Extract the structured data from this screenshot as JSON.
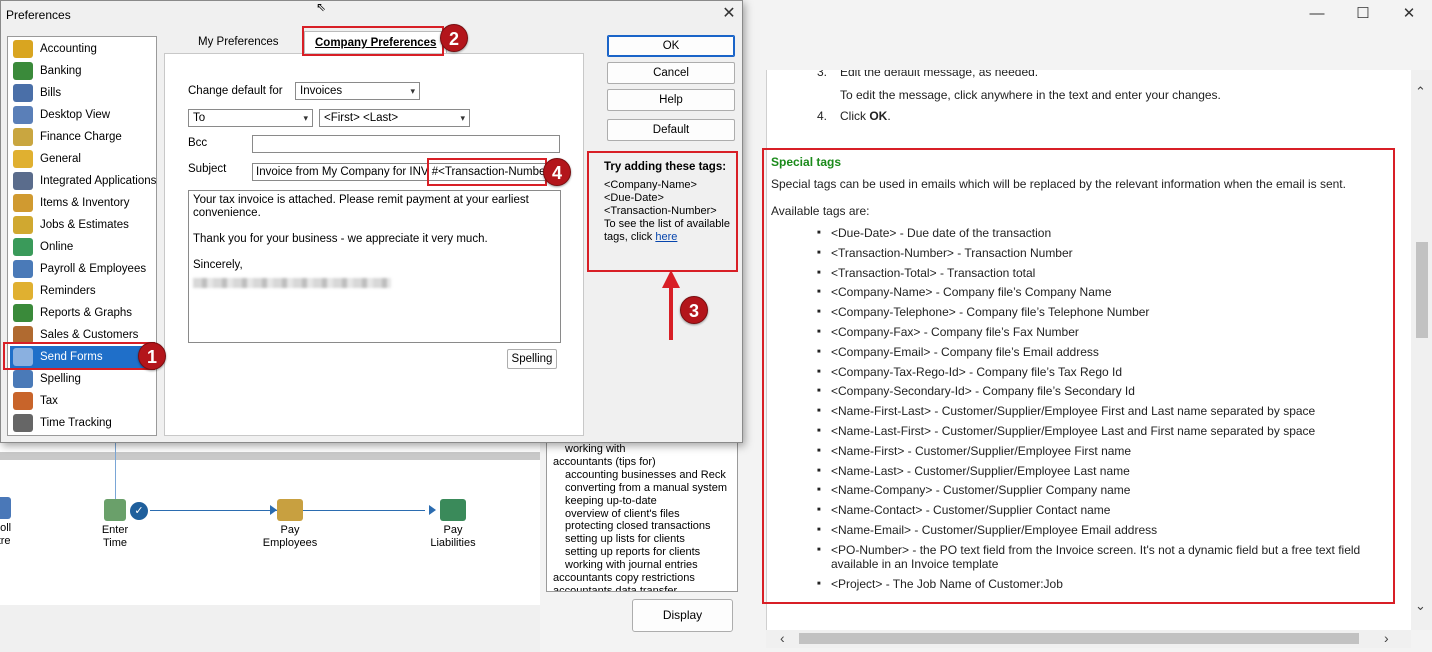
{
  "workflow": {
    "items": [
      {
        "label1": "ayroll",
        "label2": "entre"
      },
      {
        "label1": "Enter",
        "label2": "Time"
      },
      {
        "label1": "Pay",
        "label2": "Employees"
      },
      {
        "label1": "Pay",
        "label2": "Liabilities"
      }
    ]
  },
  "help_index": {
    "items": [
      {
        "text": "working with",
        "indent": 1
      },
      {
        "text": "accountants (tips for)",
        "indent": 0
      },
      {
        "text": "accounting businesses and Reck",
        "indent": 1
      },
      {
        "text": "converting from a manual system",
        "indent": 1
      },
      {
        "text": "keeping up-to-date",
        "indent": 1
      },
      {
        "text": "overview of client's files",
        "indent": 1
      },
      {
        "text": "protecting closed transactions",
        "indent": 1
      },
      {
        "text": "setting up lists for clients",
        "indent": 1
      },
      {
        "text": "setting up reports for clients",
        "indent": 1
      },
      {
        "text": "working with journal entries",
        "indent": 1
      },
      {
        "text": "accountants copy restrictions",
        "indent": 0
      },
      {
        "text": "accountants data transfer",
        "indent": 0
      }
    ],
    "display_button": "Display"
  },
  "help": {
    "step3_num": "3.",
    "step3_text": "Edit the default message, as needed.",
    "step3_sub": "To edit the message, click anywhere in the text and enter your changes.",
    "step4_num": "4.",
    "step4_text": "Click ",
    "step4_bold": "OK",
    "step4_end": ".",
    "special_title": "Special tags",
    "special_desc": "Special tags can be used in emails which will be replaced by the relevant information when the email is sent.",
    "available": "Available tags are:",
    "tags": [
      "<Due-Date> - Due date of the transaction",
      "<Transaction-Number> - Transaction Number",
      "<Transaction-Total> - Transaction total",
      "<Company-Name> - Company file’s Company Name",
      "<Company-Telephone> - Company file’s Telephone Number",
      "<Company-Fax> - Company file’s Fax Number",
      "<Company-Email> - Company file’s Email address",
      "<Company-Tax-Rego-Id> - Company file’s Tax Rego Id",
      "<Company-Secondary-Id> - Company file’s Secondary Id",
      "<Name-First-Last> - Customer/Supplier/Employee First and Last name separated by space",
      "<Name-Last-First> - Customer/Supplier/Employee Last and First name separated by space",
      "<Name-First> - Customer/Supplier/Employee First name",
      "<Name-Last> - Customer/Supplier/Employee Last name",
      "<Name-Company> - Customer/Supplier Company name",
      "<Name-Contact> - Customer/Supplier Contact name",
      "<Name-Email> - Customer/Supplier/Employee Email address",
      "<PO-Number> - the PO text field from the Invoice screen. It's not a dynamic field but a free text field available in an Invoice template",
      "<Project> - The Job Name of Customer:Job"
    ]
  },
  "preferences": {
    "title": "Preferences",
    "categories": [
      {
        "label": "Accounting",
        "color": "#d9a520"
      },
      {
        "label": "Banking",
        "color": "#3a8a3a"
      },
      {
        "label": "Bills",
        "color": "#4a6fa8"
      },
      {
        "label": "Desktop View",
        "color": "#5a7fb8"
      },
      {
        "label": "Finance Charge",
        "color": "#c9a640"
      },
      {
        "label": "General",
        "color": "#e0b030"
      },
      {
        "label": "Integrated Applications",
        "color": "#5a6c8c"
      },
      {
        "label": "Items & Inventory",
        "color": "#d09a30"
      },
      {
        "label": "Jobs & Estimates",
        "color": "#d0a830"
      },
      {
        "label": "Online",
        "color": "#3a9a5a"
      },
      {
        "label": "Payroll & Employees",
        "color": "#4a7ab8"
      },
      {
        "label": "Reminders",
        "color": "#e0b030"
      },
      {
        "label": "Reports & Graphs",
        "color": "#3a8a3a"
      },
      {
        "label": "Sales & Customers",
        "color": "#b06a30"
      },
      {
        "label": "Send Forms",
        "color": "#8ab0e0"
      },
      {
        "label": "Spelling",
        "color": "#4a7ab8"
      },
      {
        "label": "Tax",
        "color": "#c8642a"
      },
      {
        "label": "Time Tracking",
        "color": "#666666"
      }
    ],
    "selected_category": "Send Forms",
    "tab_my": "My Preferences",
    "tab_company": "Company Preferences",
    "change_default_label": "Change default for",
    "change_default_value": "Invoices",
    "to_value": "To",
    "name_value": "<First> <Last>",
    "bcc_label": "Bcc",
    "bcc_value": "",
    "subject_label": "Subject",
    "subject_value": "Invoice from My Company for INV #<Transaction-Number>",
    "message_lines": [
      "Your tax invoice is attached.  Please remit payment at your earliest convenience.",
      "Thank you for your business - we appreciate it very much.",
      "Sincerely,"
    ],
    "spelling_button": "Spelling",
    "ok_button": "OK",
    "cancel_button": "Cancel",
    "help_button": "Help",
    "default_button": "Default",
    "tip_title": "Try adding these tags:",
    "tip_tags": [
      "<Company-Name>",
      "<Due-Date>",
      "<Transaction-Number>"
    ],
    "tip_text": "To see the list of available tags, click ",
    "tip_link": "here"
  },
  "annotations": {
    "badge1": "1",
    "badge2": "2",
    "badge3": "3",
    "badge4": "4",
    "color": "#d81f26"
  }
}
